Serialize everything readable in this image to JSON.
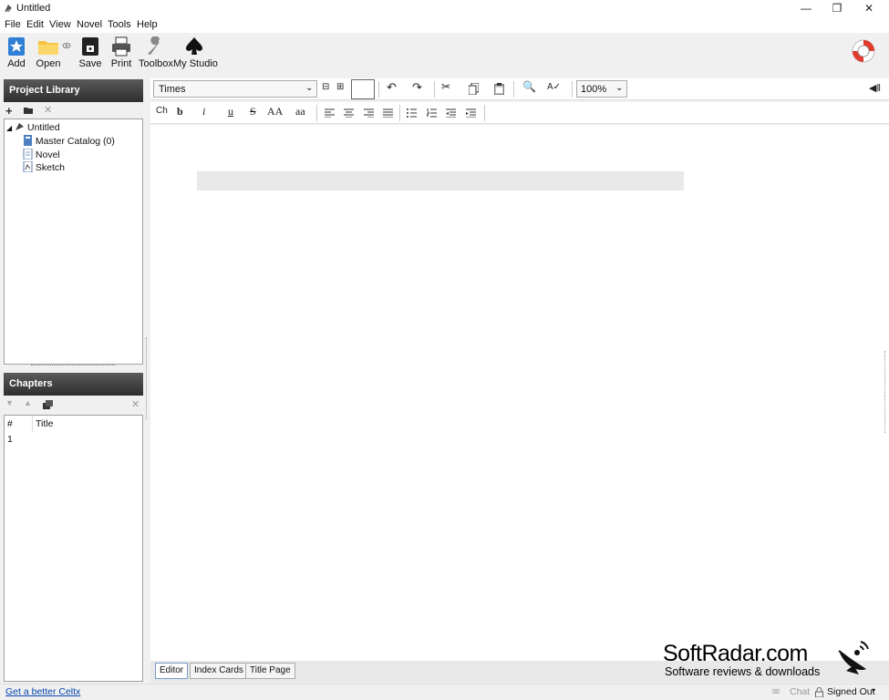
{
  "window": {
    "title": "Untitled"
  },
  "menu": [
    "File",
    "Edit",
    "View",
    "Novel",
    "Tools",
    "Help"
  ],
  "toolbar": {
    "add": "Add",
    "open": "Open",
    "save": "Save",
    "print": "Print",
    "toolbox": "Toolbox",
    "studio": "My Studio"
  },
  "library": {
    "header": "Project Library",
    "root": "Untitled",
    "items": [
      "Master Catalog (0)",
      "Novel",
      "Sketch"
    ]
  },
  "chapters": {
    "header": "Chapters",
    "col_num": "#",
    "col_title": "Title",
    "rows": [
      "1"
    ]
  },
  "format": {
    "font": "Times",
    "zoom": "100%",
    "style_ch": "Ch",
    "bold": "b",
    "italic": "i",
    "underline": "u",
    "strike": "S",
    "upper": "AA",
    "lower": "aa"
  },
  "tabs": [
    "Editor",
    "Index Cards",
    "Title Page"
  ],
  "status": {
    "link": "Get a better Celtx",
    "chat": "Chat",
    "signed": "Signed Out"
  },
  "watermark": {
    "brand": "SoftRadar.com",
    "tagline": "Software reviews & downloads"
  },
  "colors": {
    "accent": "#1e72c8",
    "link": "#0645ad"
  }
}
